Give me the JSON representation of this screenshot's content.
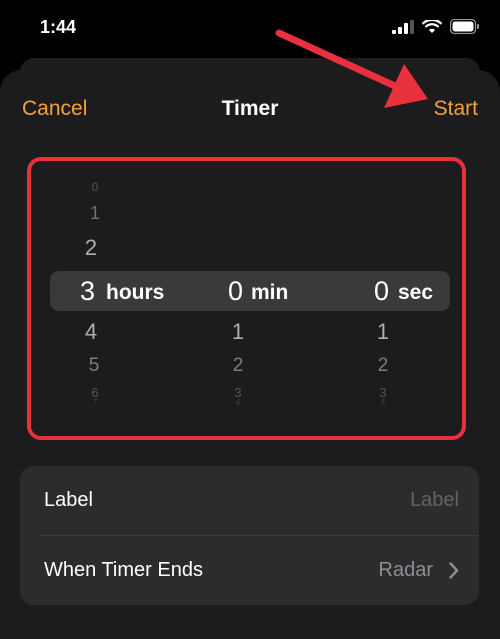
{
  "status_bar": {
    "time": "1:44"
  },
  "nav": {
    "cancel": "Cancel",
    "title": "Timer",
    "start": "Start"
  },
  "picker": {
    "hours": {
      "above": [
        "0",
        "1",
        "2"
      ],
      "selected": "3",
      "unit": "hours",
      "below": [
        "4",
        "5",
        "6",
        "7"
      ]
    },
    "minutes": {
      "selected": "0",
      "unit": "min",
      "below": [
        "1",
        "2",
        "3",
        "4"
      ]
    },
    "seconds": {
      "selected": "0",
      "unit": "sec",
      "below": [
        "1",
        "2",
        "3",
        "4"
      ]
    }
  },
  "settings": {
    "label_row": {
      "title": "Label",
      "placeholder": "Label"
    },
    "ends_row": {
      "title": "When Timer Ends",
      "value": "Radar"
    }
  },
  "colors": {
    "accent": "#f7a13a",
    "highlight_frame": "#e8313d",
    "arrow": "#e8313d"
  },
  "icons": [
    "signal-icon",
    "wifi-icon",
    "battery-icon",
    "chevron-right-icon",
    "arrow-annotation-icon"
  ]
}
